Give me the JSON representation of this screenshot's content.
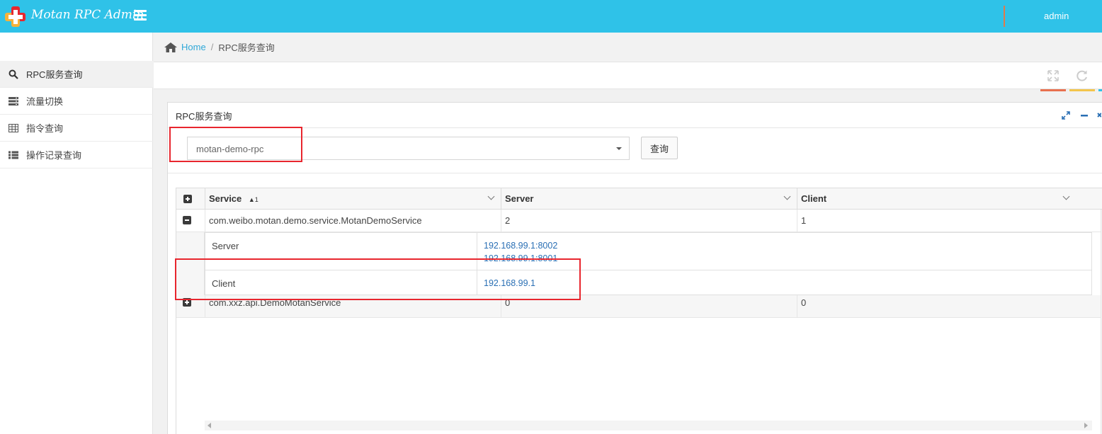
{
  "app": {
    "title": "Motan RPC Admin",
    "user": "admin"
  },
  "sidebar": {
    "items": [
      {
        "label": "RPC服务查询",
        "icon": "search-icon",
        "active": true
      },
      {
        "label": "流量切换",
        "icon": "server-icon",
        "active": false
      },
      {
        "label": "指令查询",
        "icon": "table-icon",
        "active": false
      },
      {
        "label": "操作记录查询",
        "icon": "list-icon",
        "active": false
      }
    ]
  },
  "breadcrumb": {
    "home": "Home",
    "separator": "/",
    "current": "RPC服务查询"
  },
  "toolbar": {
    "colors": [
      "#e8704f",
      "#f3c54c",
      "#2fc2e8"
    ]
  },
  "widget": {
    "title": "RPC服务查询",
    "select_value": "motan-demo-rpc",
    "query_button": "查询"
  },
  "grid": {
    "columns": [
      {
        "label": "Service",
        "sort": "▲1"
      },
      {
        "label": "Server"
      },
      {
        "label": "Client"
      }
    ],
    "rows": [
      {
        "service": "com.weibo.motan.demo.service.MotanDemoService",
        "server": "2",
        "client": "1",
        "expanded": true,
        "detail": {
          "server_label": "Server",
          "servers": [
            "192.168.99.1:8002",
            "192.168.99.1:8001"
          ],
          "client_label": "Client",
          "clients": [
            "192.168.99.1"
          ]
        }
      },
      {
        "service": "com.xxz.api.DemoMotanService",
        "server": "0",
        "client": "0",
        "expanded": false
      }
    ]
  }
}
